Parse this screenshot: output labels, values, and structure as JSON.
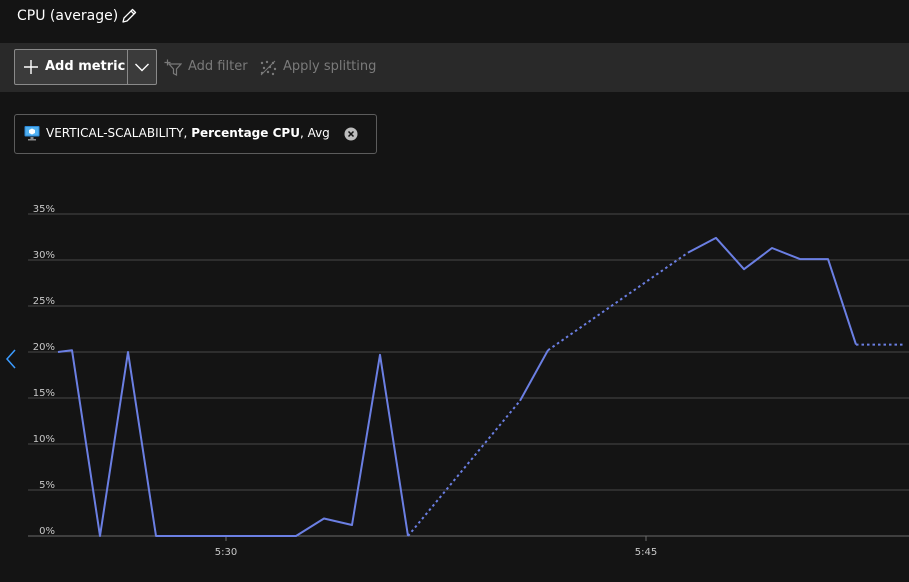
{
  "title": {
    "text": "CPU (average)",
    "edit_icon": "pencil-icon"
  },
  "toolbar": {
    "add_metric_label": "Add metric",
    "dropdown_icon": "chevron-down-icon",
    "add_filter_label": "Add filter",
    "apply_splitting_label": "Apply splitting"
  },
  "metric_pill": {
    "resource": "VERTICAL-SCALABILITY,",
    "metric": "Percentage CPU",
    "aggregation": ", Avg"
  },
  "colors": {
    "series": "#6b7fe3",
    "background": "#141414",
    "grid": "#474747"
  },
  "chart_data": {
    "type": "line",
    "ylabel": "",
    "xlabel": "",
    "ylim": [
      0,
      35
    ],
    "yticks": [
      "0%",
      "5%",
      "10%",
      "15%",
      "20%",
      "25%",
      "30%",
      "35%"
    ],
    "xticks": [
      "5:30",
      "5:45"
    ],
    "grid": true,
    "legend": "none",
    "series": [
      {
        "segments": [
          {
            "style": "solid",
            "points": [
              [
                0,
                20
              ],
              [
                0.5,
                20.2
              ],
              [
                1.5,
                0
              ],
              [
                2.5,
                20
              ],
              [
                3.5,
                0
              ],
              [
                8.5,
                0
              ],
              [
                9.5,
                1.9
              ],
              [
                10.5,
                1.2
              ],
              [
                11.5,
                19.7
              ],
              [
                12.5,
                0
              ]
            ]
          },
          {
            "style": "dotted",
            "points": [
              [
                12.5,
                0
              ],
              [
                16.5,
                14.7
              ]
            ]
          },
          {
            "style": "solid",
            "points": [
              [
                16.5,
                14.7
              ],
              [
                17.5,
                20.2
              ]
            ]
          },
          {
            "style": "dotted",
            "points": [
              [
                17.5,
                20.2
              ],
              [
                22.5,
                30.8
              ]
            ]
          },
          {
            "style": "solid",
            "points": [
              [
                22.5,
                30.8
              ],
              [
                23.5,
                32.4
              ],
              [
                24.5,
                29
              ],
              [
                25.5,
                31.3
              ],
              [
                26.5,
                30.1
              ],
              [
                27.5,
                30.1
              ],
              [
                28.5,
                20.8
              ]
            ]
          },
          {
            "style": "dotted",
            "points": [
              [
                28.5,
                20.8
              ],
              [
                30.2,
                20.8
              ]
            ]
          }
        ]
      }
    ],
    "xtick_positions_minutes": [
      6,
      21
    ]
  }
}
